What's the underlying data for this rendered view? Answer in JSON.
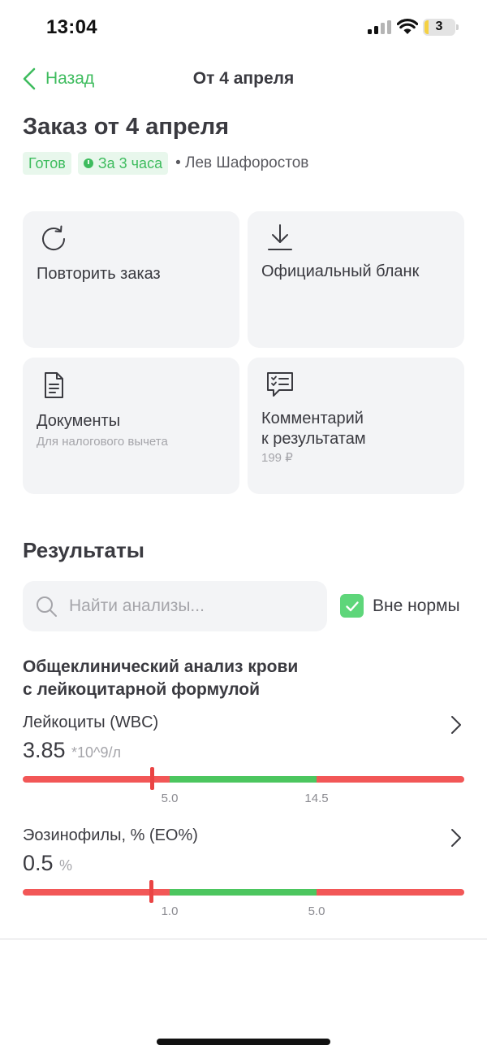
{
  "status_bar": {
    "time": "13:04",
    "battery": "3"
  },
  "nav": {
    "back_label": "Назад",
    "title": "От 4 апреля"
  },
  "order": {
    "title": "Заказ от 4 апреля",
    "status": "Готов",
    "duration": "За 3 часа",
    "person": "• Лев Шафоростов"
  },
  "actions": [
    {
      "label": "Повторить заказ",
      "sub": "",
      "icon": "refresh-icon"
    },
    {
      "label": "Официальный бланк",
      "sub": "",
      "icon": "download-icon"
    },
    {
      "label": "Документы",
      "sub": "Для налогового вычета",
      "icon": "document-icon"
    },
    {
      "label_line1": "Комментарий",
      "label_line2": "к результатам",
      "sub": "199 ₽",
      "icon": "comment-checklist-icon"
    }
  ],
  "results": {
    "title": "Результаты",
    "search_placeholder": "Найти анализы...",
    "filter_label": "Вне нормы",
    "filter_checked": true,
    "group_title_line1": "Общеклинический анализ крови",
    "group_title_line2": "с лейкоцитарной формулой",
    "items": [
      {
        "name": "Лейкоциты (WBC)",
        "value": "3.85",
        "unit": "*10^9/л",
        "ref_low": "5.0",
        "ref_high": "14.5"
      },
      {
        "name": "Эозинофилы, % (EO%)",
        "value": "0.5",
        "unit": "%",
        "ref_low": "1.0",
        "ref_high": "5.0"
      }
    ]
  },
  "colors": {
    "accent_green": "#3ebc5e",
    "range_normal": "#4cc65f",
    "range_out": "#f25757",
    "marker": "#ea4444",
    "card_bg": "#f3f4f6"
  }
}
